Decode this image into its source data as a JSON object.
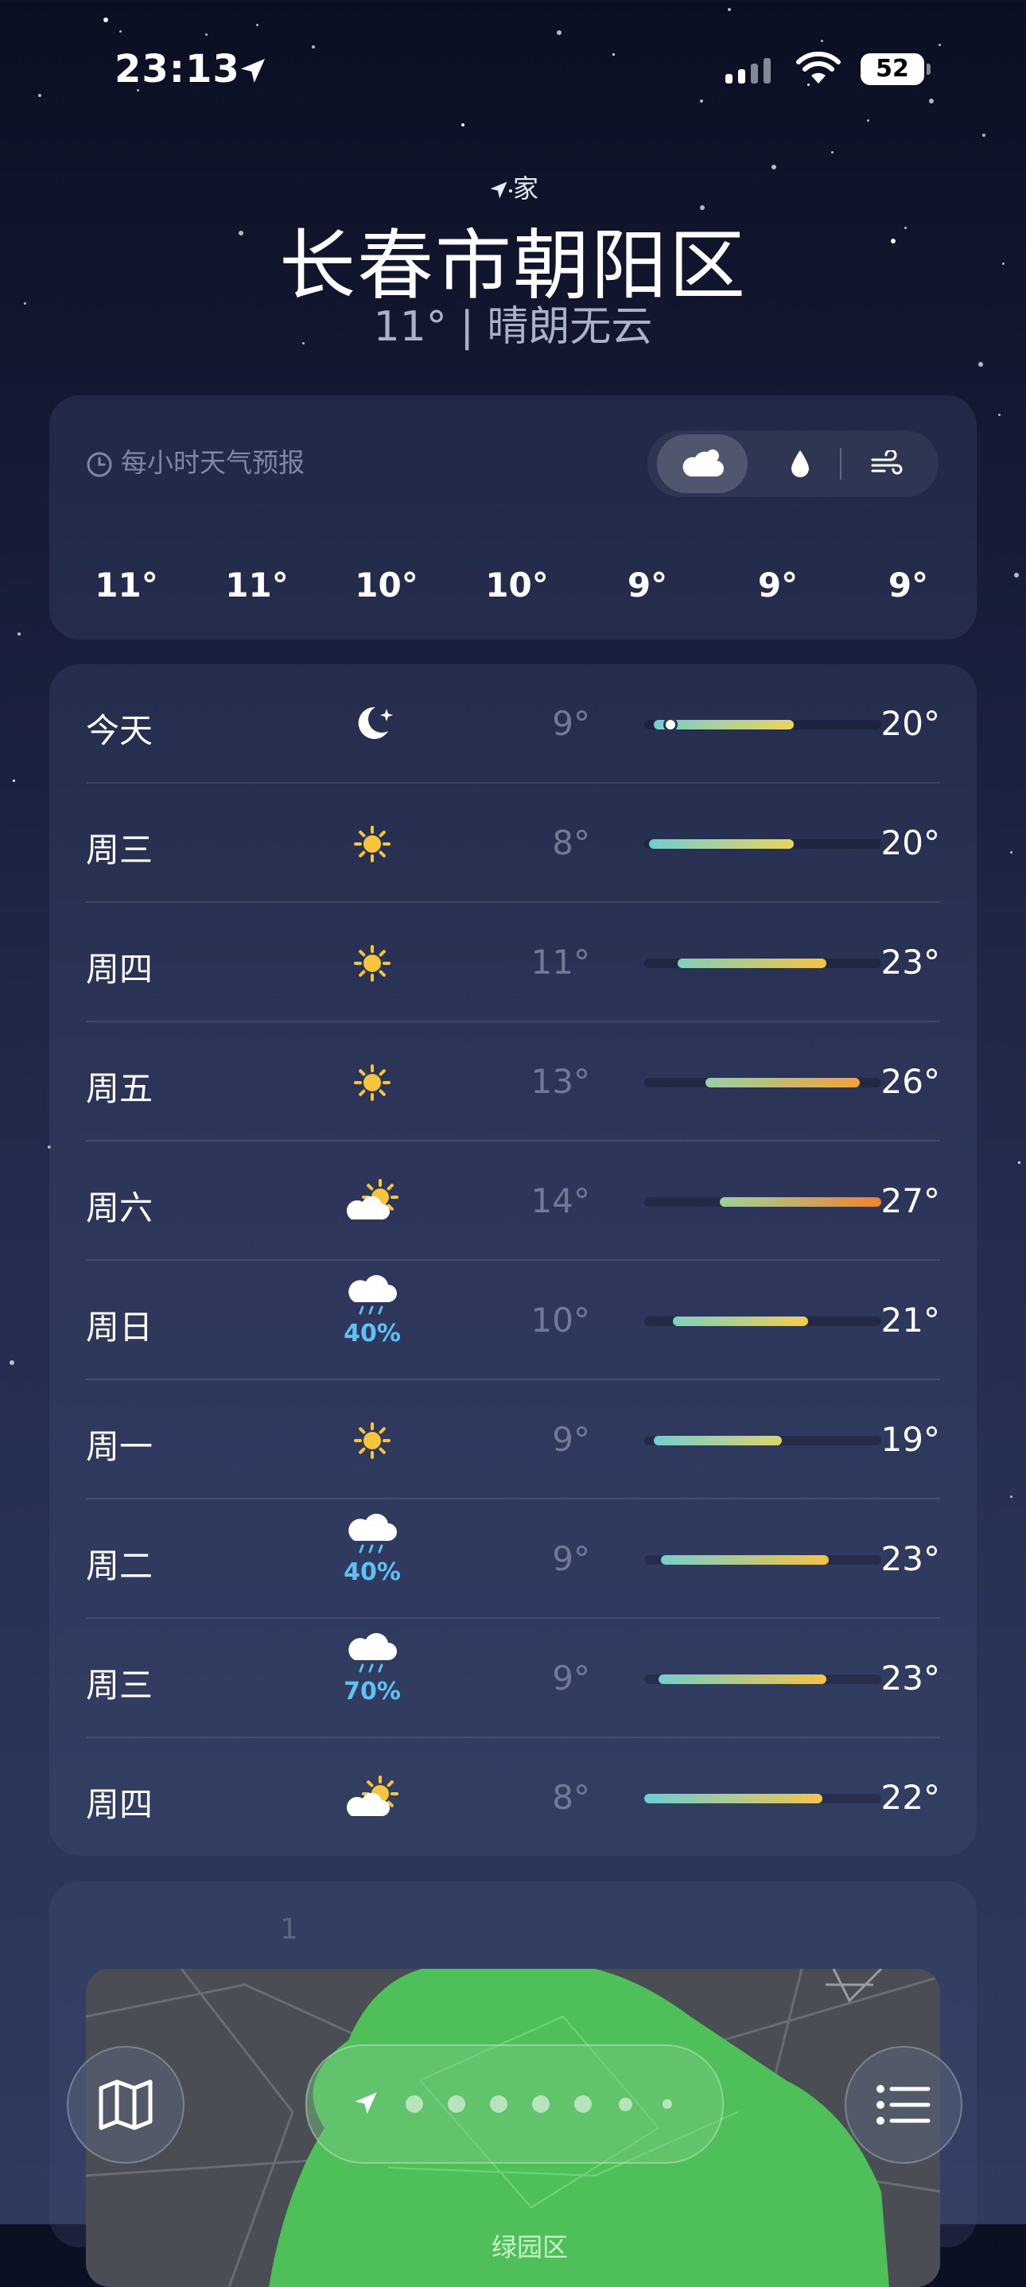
{
  "status_bar": {
    "time": "23:13",
    "battery": "52"
  },
  "location": {
    "home_label": "家",
    "city": "长春市朝阳区",
    "current_condition": "11° | 晴朗无云"
  },
  "hourly": {
    "title": "每小时天气预报",
    "modes": [
      "cloud-icon",
      "raindrop-icon",
      "wind-icon"
    ],
    "temps": [
      "11°",
      "11°",
      "10°",
      "10°",
      "9°",
      "9°",
      "9°"
    ]
  },
  "daily": [
    {
      "day": "今天",
      "icon": "moon-stars-icon",
      "pop": "",
      "low": "9°",
      "high": "20°",
      "range": [
        0.04,
        0.63
      ],
      "current": 0.11
    },
    {
      "day": "周三",
      "icon": "sun-icon",
      "pop": "",
      "low": "8°",
      "high": "20°",
      "range": [
        0.02,
        0.63
      ]
    },
    {
      "day": "周四",
      "icon": "sun-icon",
      "pop": "",
      "low": "11°",
      "high": "23°",
      "range": [
        0.14,
        0.77
      ]
    },
    {
      "day": "周五",
      "icon": "sun-icon",
      "pop": "",
      "low": "13°",
      "high": "26°",
      "range": [
        0.26,
        0.91
      ]
    },
    {
      "day": "周六",
      "icon": "partly-sunny-icon",
      "pop": "",
      "low": "14°",
      "high": "27°",
      "range": [
        0.32,
        1.0
      ]
    },
    {
      "day": "周日",
      "icon": "rain-icon",
      "pop": "40%",
      "low": "10°",
      "high": "21°",
      "range": [
        0.12,
        0.69
      ]
    },
    {
      "day": "周一",
      "icon": "sun-icon",
      "pop": "",
      "low": "9°",
      "high": "19°",
      "range": [
        0.04,
        0.58
      ]
    },
    {
      "day": "周二",
      "icon": "rain-icon",
      "pop": "40%",
      "low": "9°",
      "high": "23°",
      "range": [
        0.07,
        0.78
      ]
    },
    {
      "day": "周三",
      "icon": "rain-icon",
      "pop": "70%",
      "low": "9°",
      "high": "23°",
      "range": [
        0.06,
        0.77
      ]
    },
    {
      "day": "周四",
      "icon": "partly-sunny-icon",
      "pop": "",
      "low": "8°",
      "high": "22°",
      "range": [
        0.0,
        0.75
      ]
    }
  ],
  "map": {
    "number": "1",
    "area_label": "绿园区"
  },
  "pager": {
    "page_count": 7,
    "active_index": 0
  }
}
